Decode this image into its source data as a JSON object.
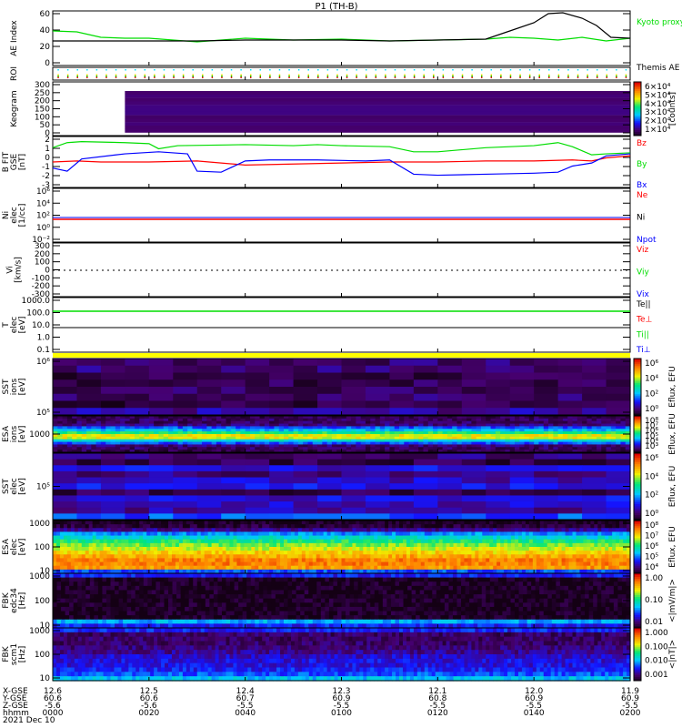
{
  "title": "P1 (TH-B)",
  "colors": {
    "green": "#00dd00",
    "red": "#ff0000",
    "blue": "#0000ff",
    "black": "#000000",
    "yellow": "#ffff00",
    "cyan": "#00e0ff"
  },
  "chart_data": {
    "type": "line",
    "x_range_minutes": [
      0,
      120
    ],
    "time_ticks": [
      "0000",
      "0020",
      "0040",
      "0100",
      "0120",
      "0140",
      "0200"
    ],
    "ephemeris": {
      "labels": [
        "X-GSE",
        "Y-GSE",
        "Z-GSE",
        "hhmm"
      ],
      "date": "2021 Dec 10",
      "X-GSE": [
        "12.6",
        "12.5",
        "12.4",
        "12.3",
        "12.1",
        "12.0",
        "11.9"
      ],
      "Y-GSE": [
        "60.6",
        "60.6",
        "60.7",
        "60.9",
        "60.8",
        "60.9",
        "60.9"
      ],
      "Z-GSE": [
        "-5.6",
        "-5.6",
        "-5.5",
        "-5.5",
        "-5.5",
        "-5.5",
        "-5.5"
      ]
    },
    "panels": [
      {
        "id": "ae",
        "ylabel": [
          "AE Index"
        ],
        "yticks": [
          "60",
          "40",
          "20",
          "0"
        ],
        "ylim": [
          0,
          60
        ],
        "legend": [
          {
            "text": "Kyoto proxy AE",
            "color": "#00dd00"
          },
          {
            "text": "Themis AE",
            "color": "#000000"
          }
        ],
        "series": [
          {
            "name": "Kyoto proxy AE",
            "color": "#00dd00",
            "t": [
              0,
              5,
              10,
              15,
              20,
              30,
              40,
              50,
              60,
              70,
              80,
              90,
              95,
              100,
              105,
              110,
              115,
              120
            ],
            "v": [
              38,
              37,
              31,
              30,
              30,
              26,
              30,
              28,
              29,
              27,
              28,
              29,
              31,
              30,
              28,
              31,
              27,
              30
            ]
          },
          {
            "name": "Themis AE",
            "color": "#000000",
            "t": [
              0,
              10,
              20,
              30,
              40,
              50,
              60,
              70,
              80,
              90,
              95,
              100,
              103,
              106,
              110,
              113,
              116,
              120
            ],
            "v": [
              27,
              27,
              27,
              27,
              28,
              28,
              28,
              27,
              28,
              29,
              38,
              47,
              57,
              58,
              52,
              44,
              31,
              30
            ]
          }
        ]
      },
      {
        "id": "roi",
        "ylabel": [
          "ROI"
        ],
        "yticks": []
      },
      {
        "id": "keogram",
        "ylabel": [
          "Keogram"
        ],
        "yticks": [
          "300",
          "250",
          "200",
          "150",
          "100",
          "50",
          "0"
        ],
        "ylim": [
          0,
          300
        ],
        "colorbar": {
          "ticks": [
            "6×10⁴",
            "5×10⁴",
            "4×10⁴",
            "3×10⁴",
            "2×10⁴",
            "1×10⁴"
          ],
          "unit": "[counts]"
        }
      },
      {
        "id": "bfield",
        "ylabel": [
          "B FIT",
          "GSE",
          "[nT]"
        ],
        "yticks": [
          "2",
          "1",
          "0",
          "-1",
          "-2",
          "-3"
        ],
        "ylim": [
          -3,
          2
        ],
        "legend": [
          {
            "text": "Bz",
            "color": "#ff0000"
          },
          {
            "text": "By",
            "color": "#00dd00"
          },
          {
            "text": "Bx",
            "color": "#0000ff"
          }
        ],
        "series": [
          {
            "name": "Bz",
            "color": "#00dd00",
            "t": [
              0,
              3,
              6,
              15,
              20,
              22,
              26,
              40,
              50,
              55,
              60,
              70,
              75,
              80,
              90,
              100,
              105,
              108,
              110,
              112,
              115,
              120
            ],
            "v": [
              0.9,
              1.4,
              1.5,
              1.4,
              1.3,
              0.8,
              1.1,
              1.2,
              1.1,
              1.2,
              1.1,
              1.0,
              0.5,
              0.5,
              0.9,
              1.1,
              1.4,
              1.0,
              0.6,
              0.2,
              0.3,
              0.4
            ]
          },
          {
            "name": "By",
            "color": "#ff0000",
            "t": [
              0,
              5,
              10,
              20,
              30,
              40,
              50,
              60,
              70,
              80,
              90,
              100,
              108,
              112,
              115,
              120
            ],
            "v": [
              -0.5,
              -0.4,
              -0.5,
              -0.5,
              -0.4,
              -0.8,
              -0.7,
              -0.6,
              -0.5,
              -0.5,
              -0.4,
              -0.4,
              -0.3,
              -0.4,
              -0.1,
              0.1
            ]
          },
          {
            "name": "Bx",
            "color": "#0000ff",
            "t": [
              0,
              3,
              6,
              15,
              22,
              28,
              30,
              35,
              40,
              45,
              55,
              65,
              70,
              75,
              80,
              90,
              100,
              105,
              108,
              112,
              115,
              120
            ],
            "v": [
              -1.1,
              -1.4,
              -0.2,
              0.3,
              0.5,
              0.3,
              -1.4,
              -1.5,
              -0.4,
              -0.3,
              -0.3,
              -0.4,
              -0.3,
              -1.7,
              -1.8,
              -1.7,
              -1.6,
              -1.5,
              -0.9,
              -0.6,
              0.1,
              0.3
            ]
          }
        ]
      },
      {
        "id": "ni",
        "ylabel": [
          "Ni",
          "elec",
          "[1/cc]"
        ],
        "yticks": [
          "10⁶",
          "10⁴",
          "10²",
          "10⁰",
          "10⁻²"
        ],
        "ylim": [
          -2,
          6
        ],
        "legend": [
          {
            "text": "Ne",
            "color": "#ff0000"
          },
          {
            "text": "Ni",
            "color": "#000000"
          },
          {
            "text": "Npot",
            "color": "#0000ff"
          }
        ]
      },
      {
        "id": "vi",
        "ylabel": [
          "Vi",
          "[km/s]"
        ],
        "yticks": [
          "300",
          "200",
          "100",
          "0",
          "-100",
          "-200",
          "-300"
        ],
        "ylim": [
          -300,
          300
        ],
        "legend": [
          {
            "text": "Viz",
            "color": "#ff0000"
          },
          {
            "text": "Viy",
            "color": "#00dd00"
          },
          {
            "text": "Vix",
            "color": "#0000ff"
          }
        ]
      },
      {
        "id": "temp",
        "ylabel": [
          "T",
          "elec",
          "[eV]"
        ],
        "yticks": [
          "1000.0",
          "100.0",
          "10.0",
          "1.0",
          "0.1"
        ],
        "ylim": [
          0.1,
          1000
        ],
        "legend": [
          {
            "text": "Te||",
            "color": "#000000"
          },
          {
            "text": "Te⊥",
            "color": "#ff0000"
          },
          {
            "text": "Ti||",
            "color": "#00dd00"
          },
          {
            "text": "Ti⊥",
            "color": "#0000ff"
          }
        ]
      },
      {
        "id": "sst-ions",
        "ylabel": [
          "SST",
          "ions",
          "[eV]"
        ],
        "yticks": [
          "10⁶",
          "10⁵"
        ],
        "colorbar": {
          "ticks": [
            "10⁶",
            "10⁴",
            "10²",
            "10⁰"
          ],
          "unit": "Eflux, EFU"
        }
      },
      {
        "id": "esa-ions",
        "ylabel": [
          "ESA",
          "ions",
          "[eV]"
        ],
        "yticks": [
          "1000"
        ],
        "colorbar": {
          "ticks": [
            "10⁸",
            "10⁷",
            "10⁶",
            "10⁵",
            "10⁴",
            "10³"
          ],
          "unit": "Eflux, EFU"
        }
      },
      {
        "id": "sst-elec",
        "ylabel": [
          "SST",
          "elec",
          "[eV]"
        ],
        "yticks": [
          "10⁵"
        ],
        "colorbar": {
          "ticks": [
            "10⁶",
            "10⁴",
            "10²",
            "10⁰"
          ],
          "unit": "Eflux, EFU"
        }
      },
      {
        "id": "esa-elec",
        "ylabel": [
          "ESA",
          "elec",
          "[eV]"
        ],
        "yticks": [
          "1000",
          "100",
          "10"
        ],
        "colorbar": {
          "ticks": [
            "10⁸",
            "10⁷",
            "10⁶",
            "10⁵",
            "10⁴"
          ],
          "unit": "Eflux, EFU"
        }
      },
      {
        "id": "fbk-edc34",
        "ylabel": [
          "FBK",
          "edc34",
          "[Hz]"
        ],
        "yticks": [
          "1000",
          "100",
          "10"
        ],
        "colorbar": {
          "ticks": [
            "1.00",
            "0.10",
            "0.01"
          ],
          "unit": "<|mV/m|>"
        }
      },
      {
        "id": "fbk-scm1",
        "ylabel": [
          "FBK",
          "scm1",
          "[Hz]"
        ],
        "yticks": [
          "1000",
          "100",
          "10"
        ],
        "colorbar": {
          "ticks": [
            "1.000",
            "0.100",
            "0.010",
            "0.001"
          ],
          "unit": "<|nT|>"
        }
      }
    ]
  }
}
